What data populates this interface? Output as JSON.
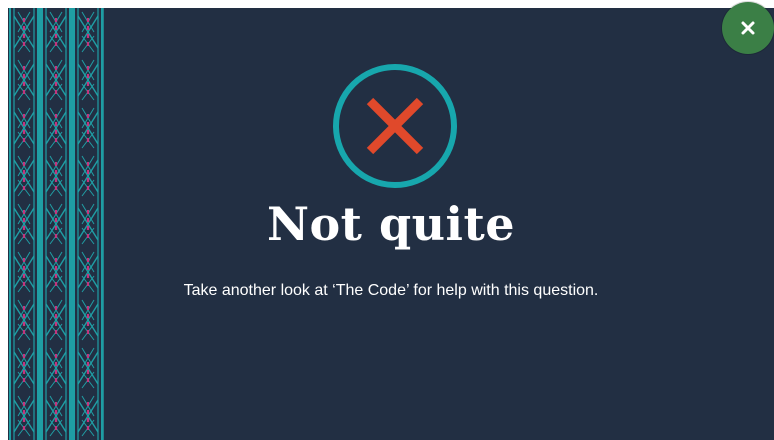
{
  "feedback": {
    "title": "Not quite",
    "message": "Take another look at ‘The Code’ for help with this question."
  },
  "close_button": {
    "icon": "close-icon"
  },
  "result_icon": "cross-icon",
  "colors": {
    "background": "#222f43",
    "ring": "#17a7ad",
    "cross": "#e0492b",
    "close_bg": "#3b7f46",
    "pattern_teal": "#1f9ea4",
    "pattern_pink": "#c2357e"
  }
}
